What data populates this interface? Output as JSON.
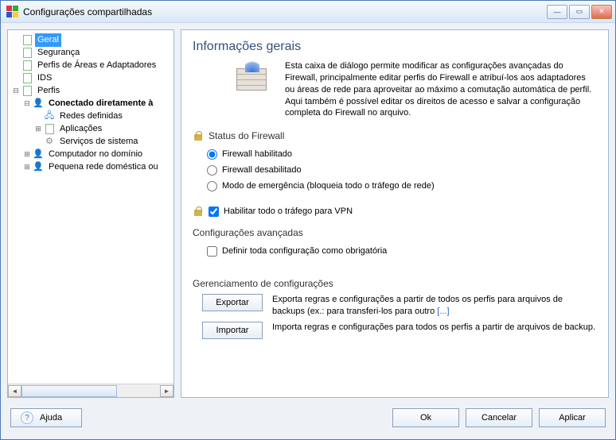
{
  "window": {
    "title": "Configurações compartilhadas"
  },
  "tree": {
    "general": "Geral",
    "security": "Segurança",
    "areas_adapters": "Perfis de Áreas e Adaptadores",
    "ids": "IDS",
    "profiles": "Perfis",
    "connected_internet": "Conectado diretamente à",
    "defined_nets": "Redes definidas",
    "applications": "Aplicações",
    "system_services": "Serviços de sistema",
    "computer_domain": "Computador no domínio",
    "small_home_net": "Pequena rede doméstica ou"
  },
  "content": {
    "title": "Informações gerais",
    "intro": "Esta caixa de diálogo permite modificar as configurações avançadas do Firewall, principalmente editar perfis do Firewall e atribuí-los aos adaptadores ou áreas de rede para aproveitar ao máximo a comutação automática de perfil. Aqui também é possível editar os direitos de acesso e salvar a configuração completa do Firewall no arquivo.",
    "status_heading": "Status do Firewall",
    "radio_enabled": "Firewall habilitado",
    "radio_disabled": "Firewall desabilitado",
    "radio_emergency": "Modo de emergência (bloqueia todo o tráfego de rede)",
    "vpn_label": "Habilitar todo o tráfego para VPN",
    "advanced_heading": "Configurações avançadas",
    "mandatory_label": "Definir toda configuração como obrigatória",
    "mgmt_heading": "Gerenciamento de configurações",
    "export_btn": "Exportar",
    "export_desc": "Exporta regras e configurações a partir de todos os perfis para arquivos de backups (ex.: para transferi-los para outro",
    "export_link": "[...]",
    "import_btn": "Importar",
    "import_desc": "Importa regras e configurações para todos os perfis a partir de arquivos de backup."
  },
  "footer": {
    "help": "Ajuda",
    "ok": "Ok",
    "cancel": "Cancelar",
    "apply": "Aplicar"
  }
}
